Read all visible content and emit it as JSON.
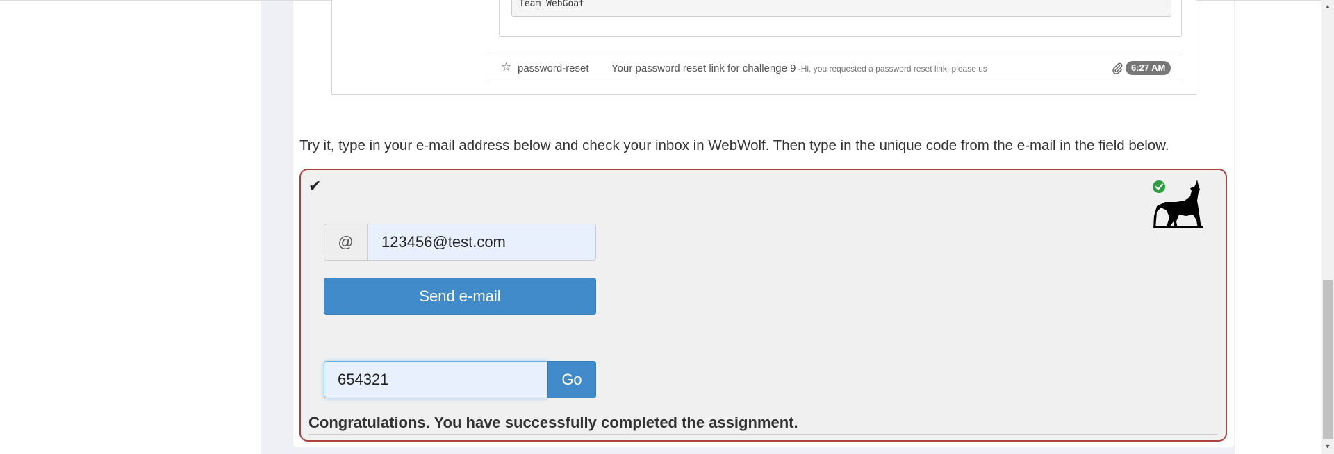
{
  "mail_preview": {
    "signature": "Team WebGoat",
    "message": {
      "sender": "password-reset",
      "subject": "Your password reset link for challenge 9",
      "preview": " -Hi, you requested a password reset link, please us",
      "time": "6:27 AM",
      "star_icon": "star-outline-icon",
      "attachment_icon": "paperclip-icon"
    }
  },
  "instruction": "Try it, type in your e-mail address below and check your inbox in WebWolf. Then type in the unique code from the e-mail in the field below.",
  "assignment": {
    "status_icon": "checkmark-icon",
    "webwolf_icon": "webwolf-howling-wolf-icon",
    "email_addon": "@",
    "email_value": "123456@test.com",
    "send_label": "Send e-mail",
    "code_value": "654321",
    "go_label": "Go",
    "feedback": "Congratulations. You have successfully completed the assignment.",
    "border_color": "#a94442",
    "button_color": "#428bca"
  }
}
